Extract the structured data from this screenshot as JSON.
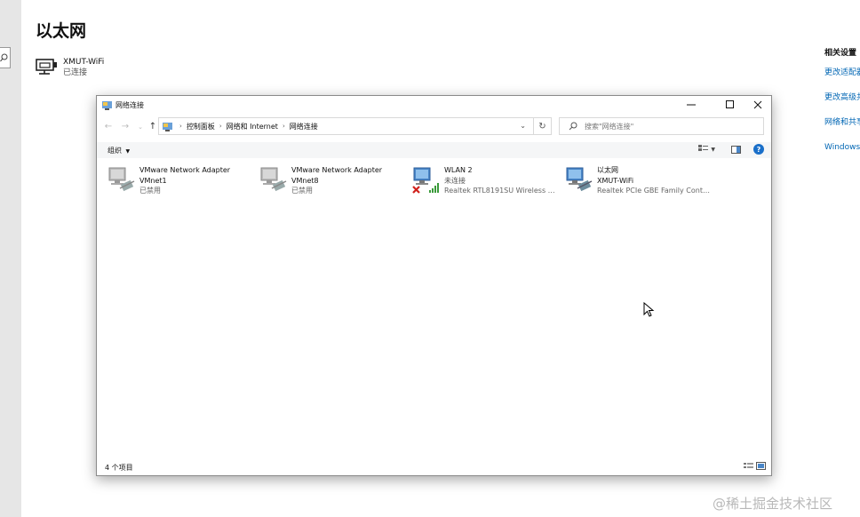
{
  "settings": {
    "page_title": "以太网",
    "network": {
      "name": "XMUT-WiFi",
      "status": "已连接"
    },
    "related": {
      "title": "相关设置",
      "links": [
        "更改适配器选项",
        "更改高级共享设置",
        "网络和共享中心",
        "Windows 防火墙"
      ]
    }
  },
  "explorer": {
    "title": "网络连接",
    "controls": {
      "minimize": "minimize-icon",
      "maximize": "maximize-icon",
      "close": "close-icon"
    },
    "breadcrumb": [
      "控制面板",
      "网络和 Internet",
      "网络连接"
    ],
    "search_placeholder": "搜索\"网络连接\"",
    "toolbar": {
      "organize": "组织"
    },
    "items": [
      {
        "name": "VMware Network Adapter",
        "line2": "VMnet1",
        "line3": "已禁用",
        "icon": "network-adapter-disabled-icon"
      },
      {
        "name": "VMware Network Adapter",
        "line2": "VMnet8",
        "line3": "已禁用",
        "icon": "network-adapter-disabled-icon"
      },
      {
        "name": "WLAN 2",
        "line2": "未连接",
        "line3": "Realtek RTL8191SU Wireless L...",
        "icon": "wifi-adapter-disconnected-icon"
      },
      {
        "name": "以太网",
        "line2": "XMUT-WiFi",
        "line3": "Realtek PCIe GBE Family Contr...",
        "icon": "ethernet-adapter-icon"
      }
    ],
    "status_count": "4 个项目",
    "colors": {
      "link": "#0066b4",
      "help": "#1a6fc9",
      "disconnect_x": "#d0211c",
      "signal": "#3a9a3a"
    }
  },
  "watermark": "@稀土掘金技术社区"
}
